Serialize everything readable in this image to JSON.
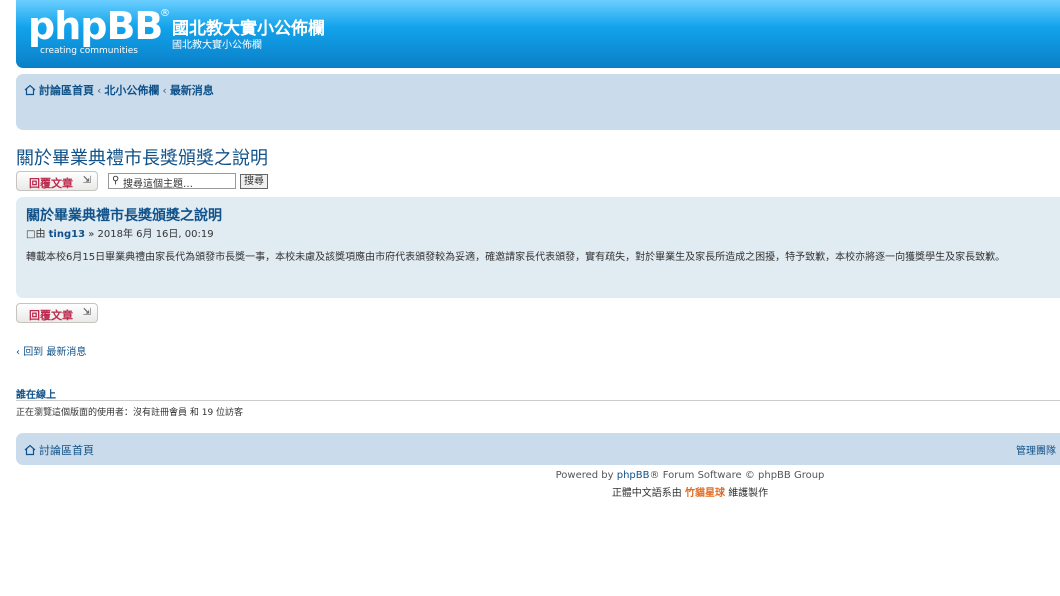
{
  "header": {
    "logo_text": "phpBB",
    "logo_reg": "®",
    "logo_sub": "creating communities",
    "site_title": "國北教大實小公佈欄",
    "site_desc": "國北教大實小公佈欄"
  },
  "breadcrumb": {
    "home": "討論區首頁",
    "sep": "‹",
    "forum": "北小公佈欄",
    "sub": "最新消息"
  },
  "topic": {
    "title": "關於畢業典禮市長獎頒獎之說明",
    "reply_label": "回覆文章",
    "reply_icon": "⇲",
    "search_placeholder": "搜尋這個主題…",
    "search_button": "搜尋"
  },
  "post": {
    "title": "關於畢業典禮市長獎頒獎之說明",
    "by_prefix": "由",
    "author": "ting13",
    "date": "» 2018年 6月 16日, 00:19",
    "body": "轉載本校6月15日畢業典禮由家長代為頒發市長獎一事，本校未慮及該獎項應由市府代表頒發較為妥適，確邀請家長代表頒發，實有疏失，對於畢業生及家長所造成之困擾，特予致歉，本校亦將逐一向獲獎學生及家長致歉。"
  },
  "back": {
    "prefix": "‹",
    "label": "回到 最新消息"
  },
  "online": {
    "title": "誰在線上",
    "text": "正在瀏覽這個版面的使用者：沒有註冊會員 和 19 位訪客"
  },
  "footer": {
    "home": "討論區首頁",
    "team": "管理團隊",
    "powered_prefix": "Powered by",
    "powered_link": "phpBB",
    "powered_suffix": "® Forum Software © phpBB Group",
    "translation_prefix": "正體中文語系由",
    "translation_brand": "竹貓星球",
    "translation_suffix": "維護製作"
  }
}
